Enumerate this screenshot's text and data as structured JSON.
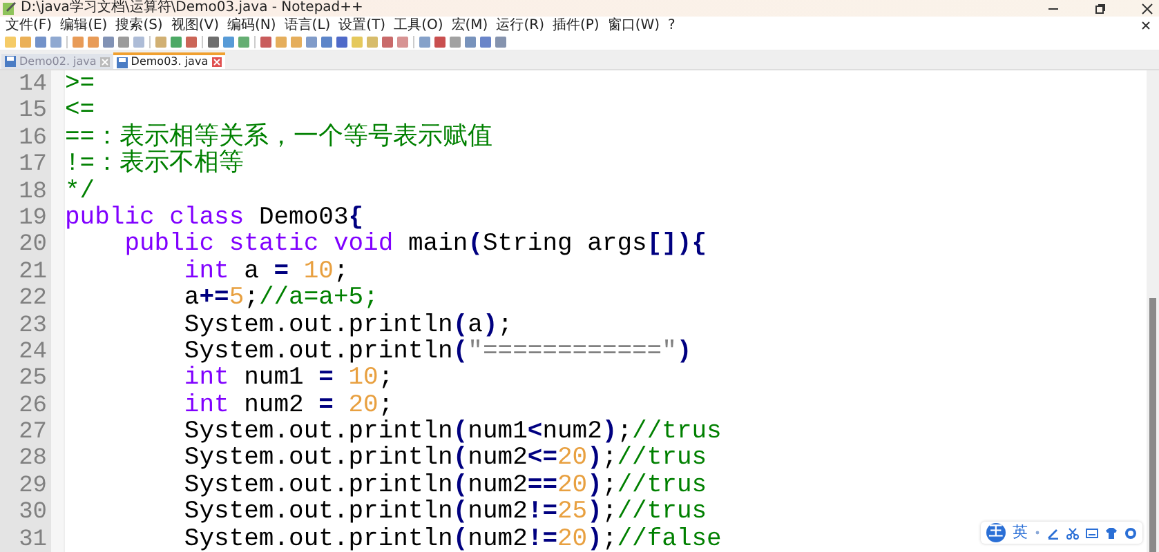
{
  "window": {
    "title": "D:\\java学习文档\\运算符\\Demo03.java - Notepad++"
  },
  "menu": [
    "文件(F)",
    "编辑(E)",
    "搜索(S)",
    "视图(V)",
    "编码(N)",
    "语言(L)",
    "设置(T)",
    "工具(O)",
    "宏(M)",
    "运行(R)",
    "插件(P)",
    "窗口(W)",
    "?"
  ],
  "tabs": [
    {
      "label": "Demo02. java",
      "selected": false
    },
    {
      "label": "Demo03. java",
      "selected": true
    }
  ],
  "lines": [
    {
      "number": "14",
      "tokens": [
        {
          "kind": "cmt",
          "text": ">="
        }
      ]
    },
    {
      "number": "15",
      "tokens": [
        {
          "kind": "cmt",
          "text": "<="
        }
      ]
    },
    {
      "number": "16",
      "tokens": [
        {
          "kind": "cmt",
          "text": "==：表示相等关系，一个等号表示赋值"
        }
      ]
    },
    {
      "number": "17",
      "tokens": [
        {
          "kind": "cmt",
          "text": "!=：表示不相等"
        }
      ]
    },
    {
      "number": "18",
      "tokens": [
        {
          "kind": "cmt",
          "text": "*/"
        }
      ]
    },
    {
      "number": "19",
      "tokens": [
        {
          "kind": "kw",
          "text": "public "
        },
        {
          "kind": "kw",
          "text": "class "
        },
        {
          "kind": "txt",
          "text": "Demo03"
        },
        {
          "kind": "op",
          "text": "{"
        }
      ]
    },
    {
      "number": "20",
      "tokens": [
        {
          "kind": "kw",
          "text": "    public "
        },
        {
          "kind": "kw",
          "text": "static "
        },
        {
          "kind": "kw",
          "text": "void "
        },
        {
          "kind": "txt",
          "text": "main"
        },
        {
          "kind": "op",
          "text": "("
        },
        {
          "kind": "txt",
          "text": "String args"
        },
        {
          "kind": "op",
          "text": "[]){"
        }
      ]
    },
    {
      "number": "21",
      "tokens": [
        {
          "kind": "kw",
          "text": "        int"
        },
        {
          "kind": "txt",
          "text": " a "
        },
        {
          "kind": "op",
          "text": "= "
        },
        {
          "kind": "num",
          "text": "10"
        },
        {
          "kind": "txt",
          "text": ";"
        }
      ]
    },
    {
      "number": "22",
      "tokens": [
        {
          "kind": "txt",
          "text": "        a"
        },
        {
          "kind": "op",
          "text": "+="
        },
        {
          "kind": "num",
          "text": "5"
        },
        {
          "kind": "txt",
          "text": ";"
        },
        {
          "kind": "cmt",
          "text": "//a=a+5;"
        }
      ]
    },
    {
      "number": "23",
      "tokens": [
        {
          "kind": "txt",
          "text": "        System.out.println"
        },
        {
          "kind": "op",
          "text": "("
        },
        {
          "kind": "txt",
          "text": "a"
        },
        {
          "kind": "op",
          "text": ")"
        },
        {
          "kind": "txt",
          "text": ";"
        }
      ]
    },
    {
      "number": "24",
      "tokens": [
        {
          "kind": "txt",
          "text": "        System.out.println"
        },
        {
          "kind": "op",
          "text": "("
        },
        {
          "kind": "str",
          "text": "\"============\""
        },
        {
          "kind": "op",
          "text": ")"
        }
      ]
    },
    {
      "number": "25",
      "tokens": [
        {
          "kind": "kw",
          "text": "        int"
        },
        {
          "kind": "txt",
          "text": " num1 "
        },
        {
          "kind": "op",
          "text": "= "
        },
        {
          "kind": "num",
          "text": "10"
        },
        {
          "kind": "txt",
          "text": ";"
        }
      ]
    },
    {
      "number": "26",
      "tokens": [
        {
          "kind": "kw",
          "text": "        int"
        },
        {
          "kind": "txt",
          "text": " num2 "
        },
        {
          "kind": "op",
          "text": "= "
        },
        {
          "kind": "num",
          "text": "20"
        },
        {
          "kind": "txt",
          "text": ";"
        }
      ]
    },
    {
      "number": "27",
      "tokens": [
        {
          "kind": "txt",
          "text": "        System.out.println"
        },
        {
          "kind": "op",
          "text": "("
        },
        {
          "kind": "txt",
          "text": "num1"
        },
        {
          "kind": "op",
          "text": "<"
        },
        {
          "kind": "txt",
          "text": "num2"
        },
        {
          "kind": "op",
          "text": ")"
        },
        {
          "kind": "txt",
          "text": ";"
        },
        {
          "kind": "cmt",
          "text": "//trus"
        }
      ]
    },
    {
      "number": "28",
      "tokens": [
        {
          "kind": "txt",
          "text": "        System.out.println"
        },
        {
          "kind": "op",
          "text": "("
        },
        {
          "kind": "txt",
          "text": "num2"
        },
        {
          "kind": "op",
          "text": "<="
        },
        {
          "kind": "num",
          "text": "20"
        },
        {
          "kind": "op",
          "text": ")"
        },
        {
          "kind": "txt",
          "text": ";"
        },
        {
          "kind": "cmt",
          "text": "//trus"
        }
      ]
    },
    {
      "number": "29",
      "tokens": [
        {
          "kind": "txt",
          "text": "        System.out.println"
        },
        {
          "kind": "op",
          "text": "("
        },
        {
          "kind": "txt",
          "text": "num2"
        },
        {
          "kind": "op",
          "text": "=="
        },
        {
          "kind": "num",
          "text": "20"
        },
        {
          "kind": "op",
          "text": ")"
        },
        {
          "kind": "txt",
          "text": ";"
        },
        {
          "kind": "cmt",
          "text": "//trus"
        }
      ]
    },
    {
      "number": "30",
      "tokens": [
        {
          "kind": "txt",
          "text": "        System.out.println"
        },
        {
          "kind": "op",
          "text": "("
        },
        {
          "kind": "txt",
          "text": "num2"
        },
        {
          "kind": "op",
          "text": "!="
        },
        {
          "kind": "num",
          "text": "25"
        },
        {
          "kind": "op",
          "text": ")"
        },
        {
          "kind": "txt",
          "text": ";"
        },
        {
          "kind": "cmt",
          "text": "//trus"
        }
      ]
    },
    {
      "number": "31",
      "tokens": [
        {
          "kind": "txt",
          "text": "        System.out.println"
        },
        {
          "kind": "op",
          "text": "("
        },
        {
          "kind": "txt",
          "text": "num2"
        },
        {
          "kind": "op",
          "text": "!="
        },
        {
          "kind": "num",
          "text": "20"
        },
        {
          "kind": "op",
          "text": ")"
        },
        {
          "kind": "txt",
          "text": ";"
        },
        {
          "kind": "cmt",
          "text": "//false"
        }
      ]
    }
  ],
  "ime_toolbar": {
    "logo": "王",
    "mode": "英"
  }
}
